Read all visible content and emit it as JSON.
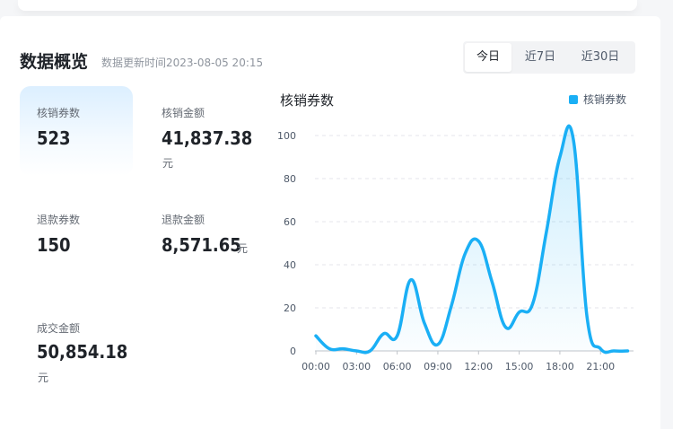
{
  "header": {
    "title": "数据概览",
    "update_text": "数据更新时间2023-08-05 20:15",
    "tabs": [
      {
        "label": "今日",
        "active": true
      },
      {
        "label": "近7日",
        "active": false
      },
      {
        "label": "近30日",
        "active": false
      }
    ]
  },
  "stats": {
    "redeemed_count": {
      "label": "核销券数",
      "value": "523"
    },
    "redeemed_amount": {
      "label": "核销金额",
      "value": "41,837.38",
      "unit": "元"
    },
    "refund_count": {
      "label": "退款券数",
      "value": "150"
    },
    "refund_amount": {
      "label": "退款金额",
      "value": "8,571.65",
      "unit": "元"
    },
    "deal_amount": {
      "label": "成交金额",
      "value": "50,854.18",
      "unit": "元"
    }
  },
  "chart_title": "核销券数",
  "colors": {
    "accent": "#1aaff5"
  },
  "chart_data": {
    "type": "area",
    "title": "核销券数",
    "legend": [
      "核销券数"
    ],
    "legend_position": "top-right",
    "grid": true,
    "ylim": [
      0,
      100
    ],
    "yticks": [
      0,
      20,
      40,
      60,
      80,
      100
    ],
    "xticks": [
      "00:00",
      "03:00",
      "06:00",
      "09:00",
      "12:00",
      "15:00",
      "18:00",
      "21:00"
    ],
    "series": [
      {
        "name": "核销券数",
        "x": [
          0,
          1,
          2,
          3,
          4,
          5,
          6,
          7,
          8,
          9,
          10,
          11,
          12,
          13,
          14,
          15,
          16,
          17,
          18,
          19,
          20,
          21,
          22,
          23
        ],
        "values": [
          7,
          1,
          1,
          0,
          0,
          8,
          7,
          33,
          13,
          3,
          21,
          45,
          51,
          32,
          11,
          18,
          22,
          55,
          90,
          98,
          16,
          1,
          0,
          0
        ]
      }
    ]
  }
}
